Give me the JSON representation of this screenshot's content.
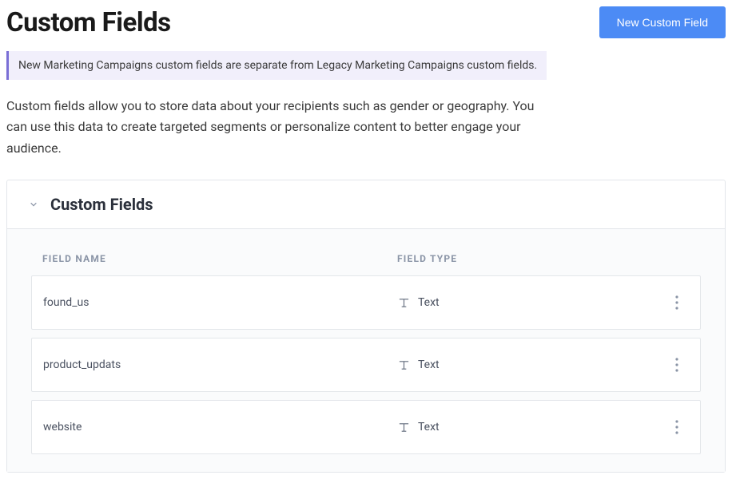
{
  "header": {
    "title": "Custom Fields",
    "new_button": "New Custom Field"
  },
  "info_banner": "New Marketing Campaigns custom fields are separate from Legacy Marketing Campaigns custom fields.",
  "description": "Custom fields allow you to store data about your recipients such as gender or geography. You can use this data to create targeted segments or personalize content to better engage your audience.",
  "panel": {
    "title": "Custom Fields",
    "columns": {
      "name": "Field Name",
      "type": "Field Type"
    },
    "rows": [
      {
        "name": "found_us",
        "type": "Text"
      },
      {
        "name": "product_updats",
        "type": "Text"
      },
      {
        "name": "website",
        "type": "Text"
      }
    ]
  }
}
